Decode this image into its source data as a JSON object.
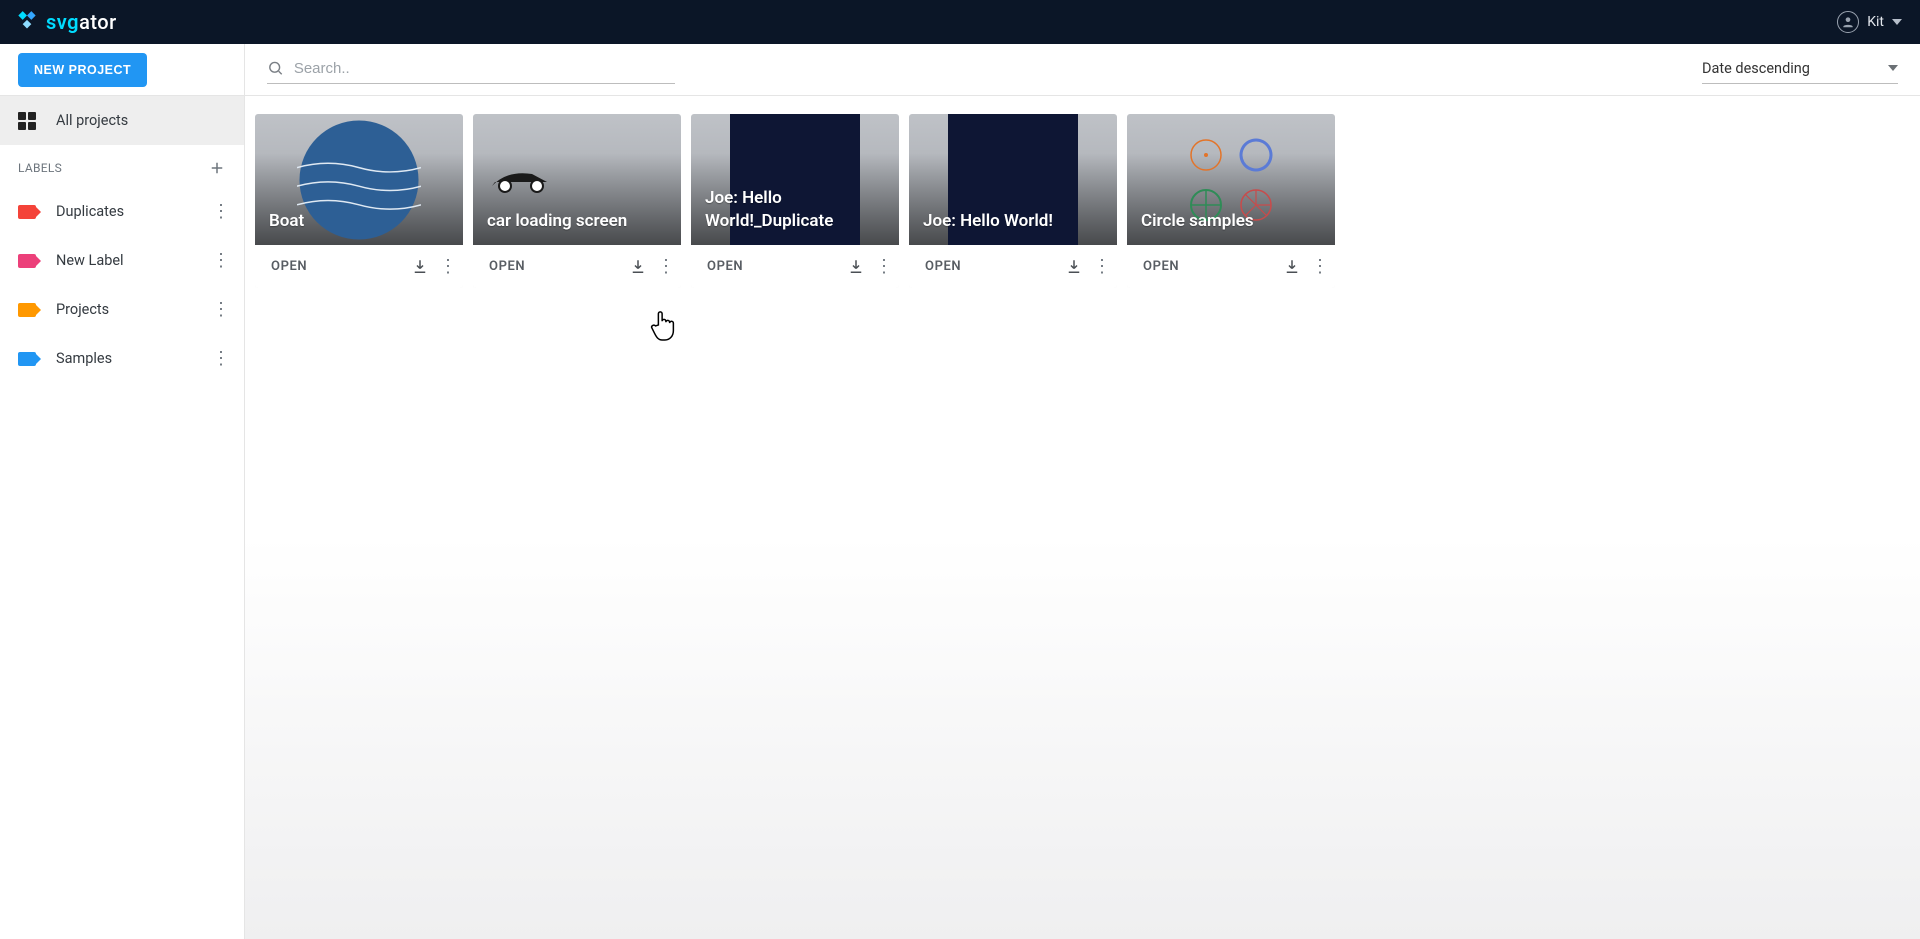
{
  "brand": {
    "name_plain": "svgator"
  },
  "user": {
    "name": "Kit"
  },
  "sidebar": {
    "new_project": "NEW PROJECT",
    "all_projects": "All projects",
    "labels_heading": "LABELS",
    "labels": [
      {
        "name": "Duplicates",
        "color": "#f44339"
      },
      {
        "name": "New Label",
        "color": "#ec407a"
      },
      {
        "name": "Projects",
        "color": "#ff9800"
      },
      {
        "name": "Samples",
        "color": "#2196f3"
      }
    ]
  },
  "toolbar": {
    "search_placeholder": "Search..",
    "sort_value": "Date descending"
  },
  "cards": {
    "open_label": "OPEN",
    "items": [
      {
        "title": "Boat"
      },
      {
        "title": "car loading screen"
      },
      {
        "title": "Joe: Hello World!_Duplicate"
      },
      {
        "title": "Joe: Hello World!"
      },
      {
        "title": "Circle samples"
      }
    ]
  }
}
